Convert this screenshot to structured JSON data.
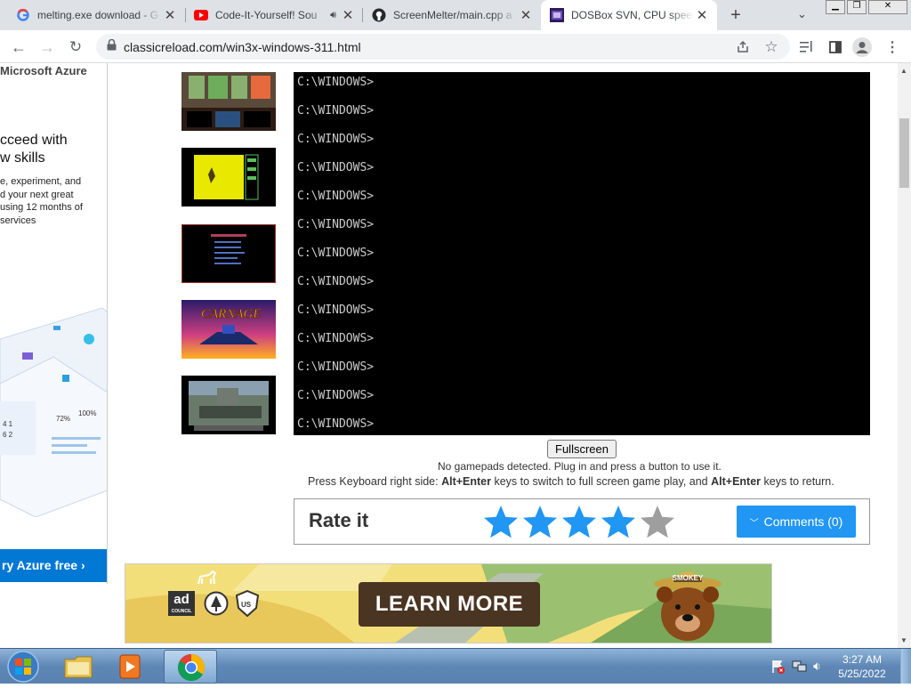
{
  "tabs": [
    {
      "title": "melting.exe download - G",
      "icon": "google-icon"
    },
    {
      "title": "Code-It-Yourself! Sou",
      "icon": "youtube-icon"
    },
    {
      "title": "ScreenMelter/main.cpp a",
      "icon": "github-icon"
    },
    {
      "title": "DOSBox SVN, CPU speed",
      "icon": "dosbox-icon",
      "active": true
    }
  ],
  "address": {
    "url": "classicreload.com/win3x-windows-311.html"
  },
  "azure_ad": {
    "heading": "Microsoft Azure",
    "tagline_1": "cceed with",
    "tagline_2": "w skills",
    "body_1": "e, experiment, and",
    "body_2": "d your next great",
    "body_3": "using 12 months of",
    "body_4": "services",
    "cta": "ry Azure free ›"
  },
  "dos_screen": {
    "lines": [
      "C:\\WINDOWS>",
      "C:\\WINDOWS>",
      "C:\\WINDOWS>",
      "C:\\WINDOWS>",
      "C:\\WINDOWS>",
      "C:\\WINDOWS>",
      "C:\\WINDOWS>",
      "C:\\WINDOWS>",
      "C:\\WINDOWS>",
      "C:\\WINDOWS>",
      "C:\\WINDOWS>",
      "C:\\WINDOWS>",
      "C:\\WINDOWS>"
    ]
  },
  "player": {
    "fullscreen": "Fullscreen",
    "gamepad": "No gamepads detected. Plug in and press a button to use it.",
    "kb_pre": "Press Keyboard right side: ",
    "kb_key1": "Alt+Enter",
    "kb_mid": " keys to switch to full screen game play, and ",
    "kb_key2": "Alt+Enter",
    "kb_post": " keys to return."
  },
  "rating": {
    "label": "Rate it",
    "stars_filled": 4,
    "stars_total": 5,
    "comments_label": "Comments (0)",
    "star_color": "#2196f3"
  },
  "bottom_ad": {
    "cta": "LEARN MORE",
    "logo_ad": "ad",
    "logo_council": "COUNCIL",
    "bear_hat": "SMOKEY"
  },
  "clock": {
    "time": "3:27 AM",
    "date": "5/25/2022"
  }
}
